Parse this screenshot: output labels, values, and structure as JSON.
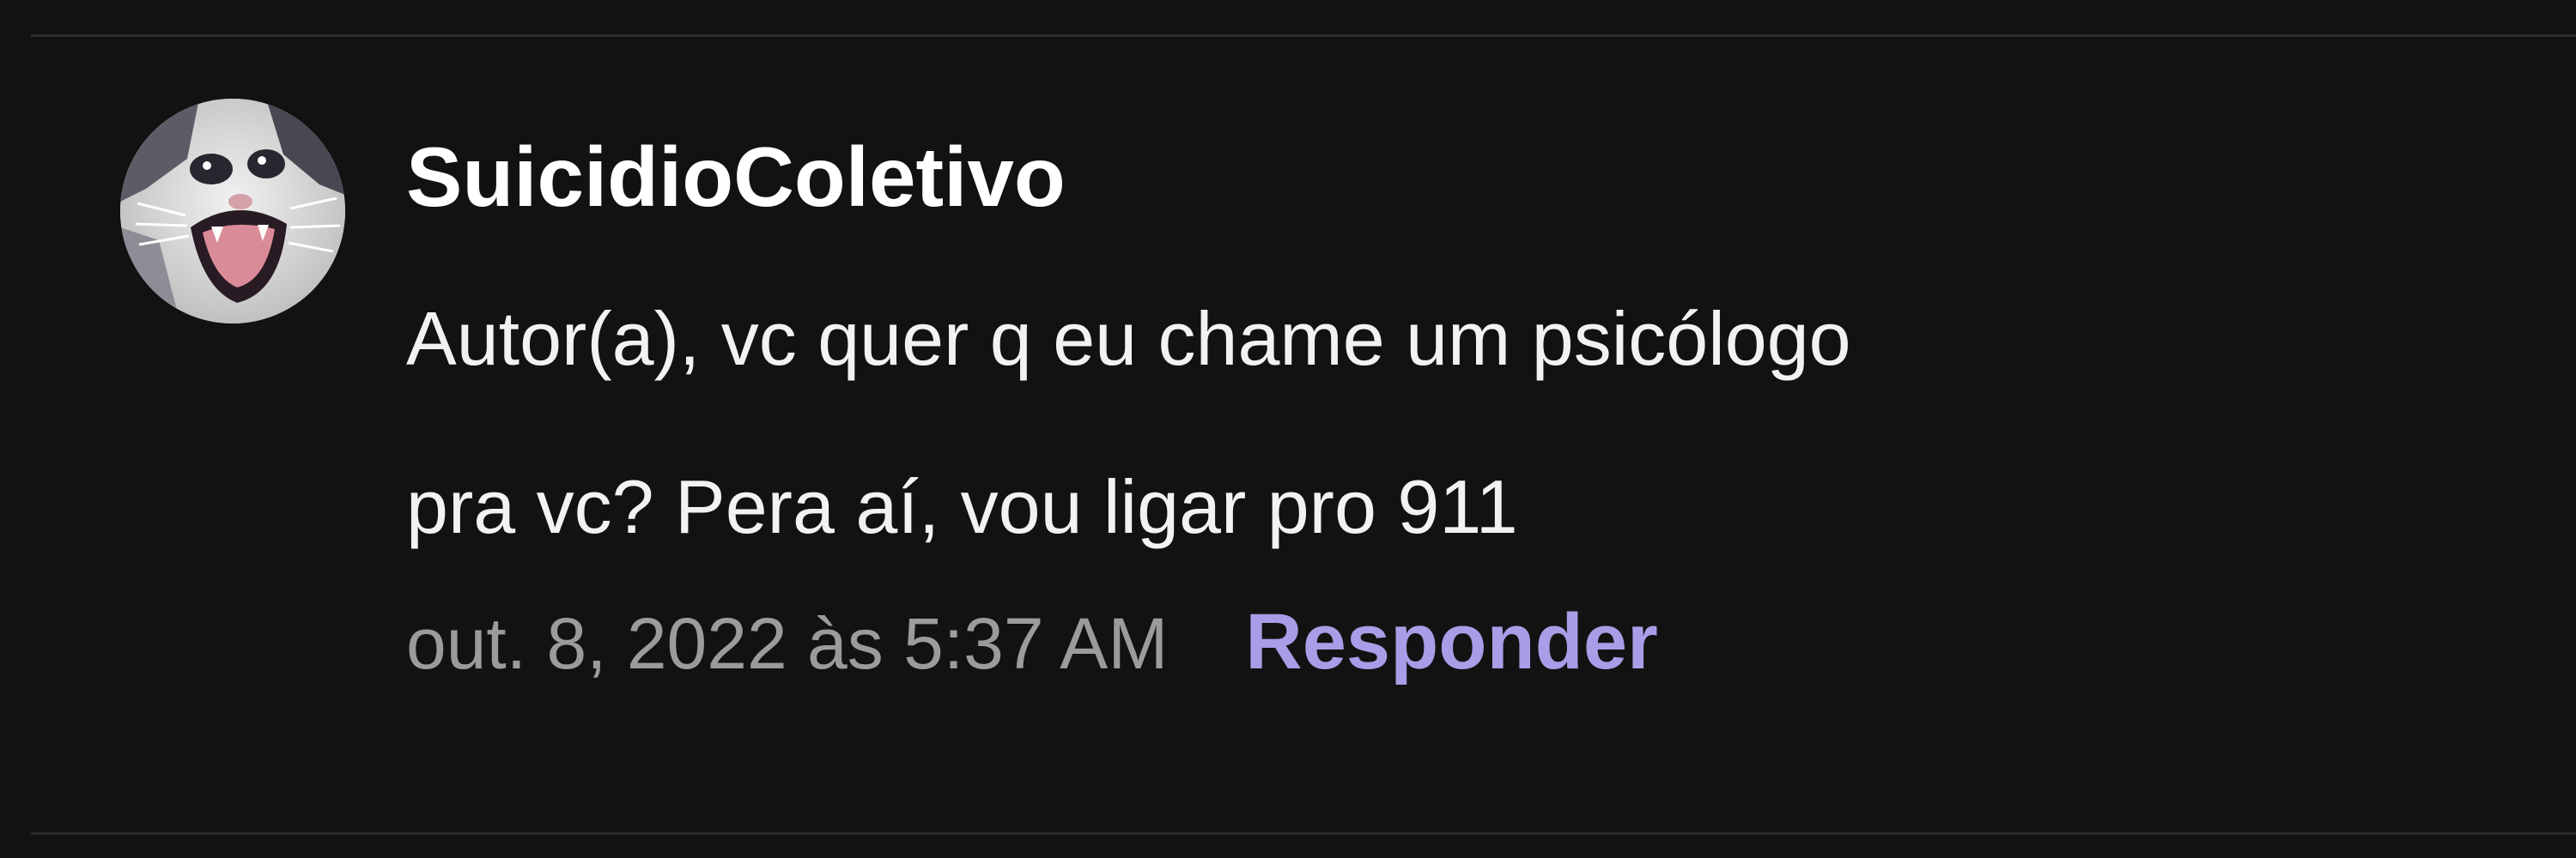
{
  "comment": {
    "author": "SuicidioColetivo",
    "text_lines": [
      "Autor(a), vc quer q eu chame um psicólogo",
      "pra vc? Pera aí, vou ligar pro 911"
    ],
    "timestamp": "out. 8, 2022 às 5:37 AM",
    "reply_label": "Responder"
  },
  "colors": {
    "background": "#121212",
    "username": "#ffffff",
    "text": "#f2f2f2",
    "timestamp": "#9b9b9b",
    "reply_link": "#a89de6"
  },
  "icons": {
    "avatar": "crying-cat-avatar"
  }
}
